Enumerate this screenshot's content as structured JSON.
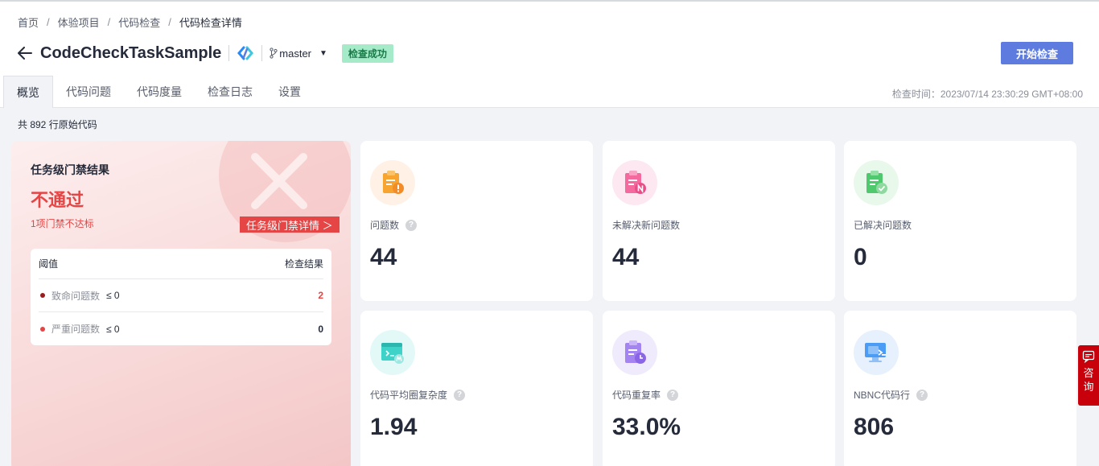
{
  "breadcrumb": [
    "首页",
    "体验项目",
    "代码检查",
    "代码检查详情"
  ],
  "breadcrumb_separator": "/",
  "task_name": "CodeCheckTaskSample",
  "branch": "master",
  "status": "检查成功",
  "start_button": "开始检查",
  "tabs": [
    {
      "label": "概览",
      "active": true
    },
    {
      "label": "代码问题",
      "active": false
    },
    {
      "label": "代码度量",
      "active": false
    },
    {
      "label": "检查日志",
      "active": false
    },
    {
      "label": "设置",
      "active": false
    }
  ],
  "check_time": "检查时间：2023/07/14 23:30:29 GMT+08:00",
  "line_count": "共 892 行原始代码",
  "gate": {
    "title": "任务级门禁结果",
    "result": "不通过",
    "subtitle": "1项门禁不达标",
    "detail_link": "任务级门禁详情 ＞",
    "table_header_left": "阈值",
    "table_header_right": "检查结果",
    "rows": [
      {
        "name": "致命问题数",
        "condition": "≤ 0",
        "value": "2",
        "dot_color": "#9a1c1c",
        "value_color": "#e54545"
      },
      {
        "name": "严重问题数",
        "condition": "≤ 0",
        "value": "0",
        "dot_color": "#e54545",
        "value_color": "#252b3a"
      }
    ]
  },
  "metrics": [
    {
      "label": "问题数",
      "value": "44",
      "help": true,
      "icon": "clipboard-warning-icon",
      "bg": "#fff1e5"
    },
    {
      "label": "未解决新问题数",
      "value": "44",
      "help": false,
      "icon": "clipboard-new-icon",
      "bg": "#fde8f1"
    },
    {
      "label": "已解决问题数",
      "value": "0",
      "help": false,
      "icon": "clipboard-check-icon",
      "bg": "#e8f8ea"
    },
    {
      "label": "代码平均圈复杂度",
      "value": "1.94",
      "help": true,
      "icon": "code-window-icon",
      "bg": "#e2f9f8"
    },
    {
      "label": "代码重复率",
      "value": "33.0%",
      "help": true,
      "icon": "clipboard-clock-icon",
      "bg": "#efebfc"
    },
    {
      "label": "NBNC代码行",
      "value": "806",
      "help": true,
      "icon": "monitor-terminal-icon",
      "bg": "#e6f1fd"
    }
  ],
  "help_glyph": "?",
  "consult": {
    "label": "咨询",
    "chars": [
      "咨",
      "询"
    ]
  }
}
